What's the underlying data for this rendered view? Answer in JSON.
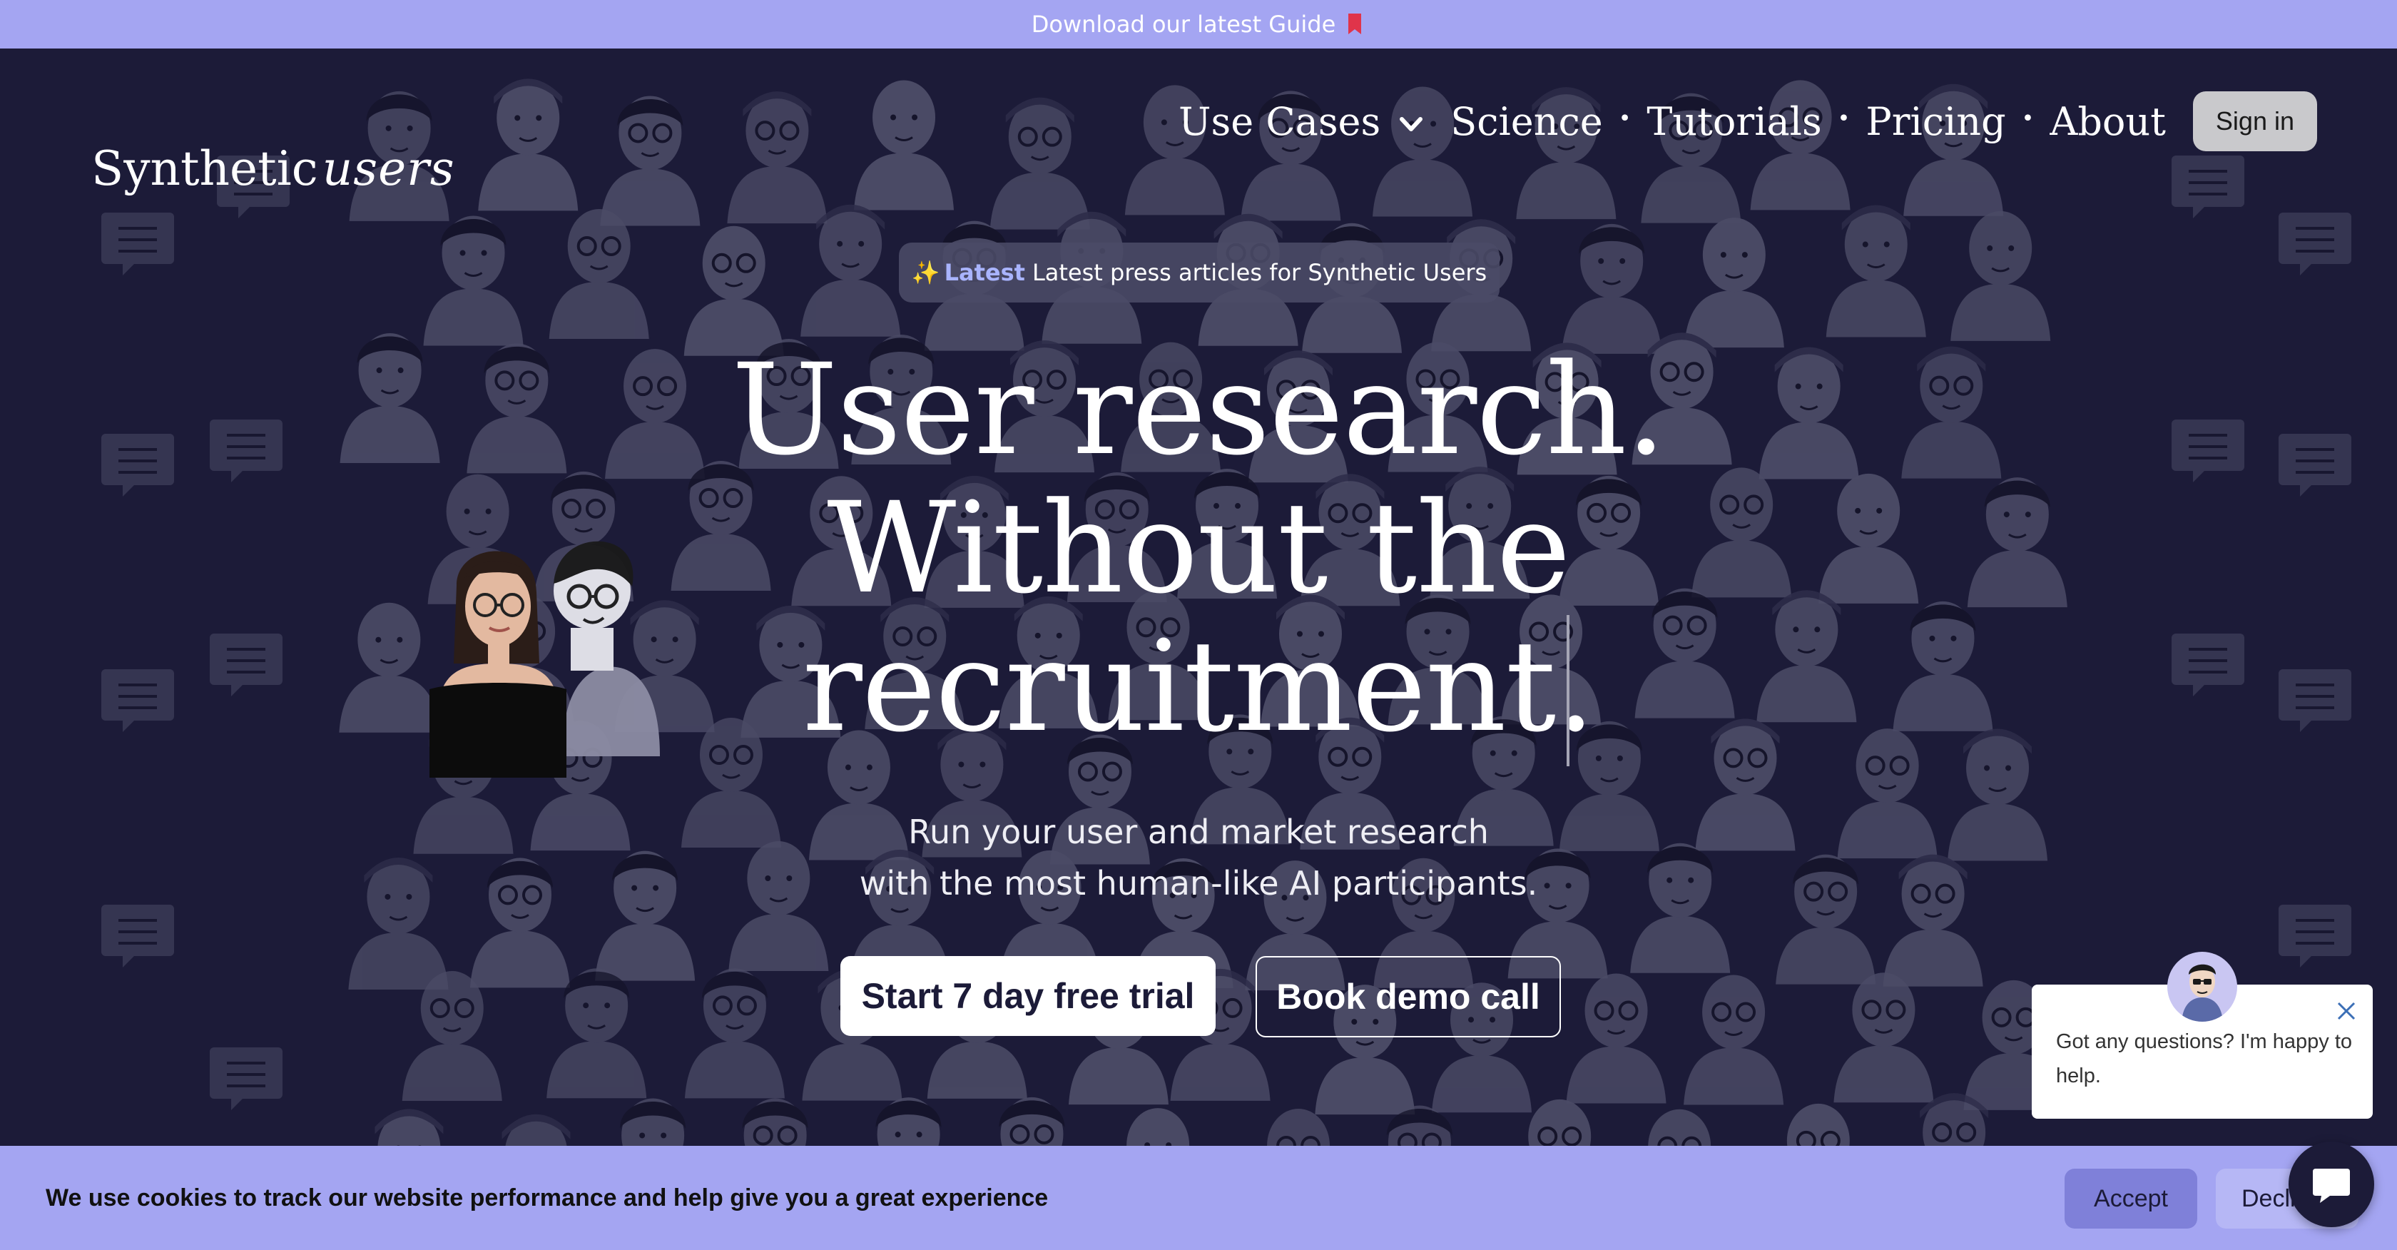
{
  "promo": {
    "text": "Download our latest Guide",
    "icon": "bookmark-icon"
  },
  "header": {
    "logo_main": "Synthetic",
    "logo_script": "users",
    "nav": [
      {
        "label": "Use Cases",
        "has_dropdown": true
      },
      {
        "label": "Science"
      },
      {
        "label": "Tutorials"
      },
      {
        "label": "Pricing"
      },
      {
        "label": "About"
      }
    ],
    "separator": "•",
    "sign_in": "Sign in"
  },
  "press": {
    "sparkle": "✨",
    "tag": "Latest",
    "text": "Latest press articles for Synthetic Users"
  },
  "hero": {
    "title_lines": [
      "User research.",
      "Without the",
      "recruitment."
    ],
    "subtitle_lines": [
      "Run your user and market research",
      "with the most human-like AI participants."
    ]
  },
  "cta": {
    "primary": "Start 7 day free trial",
    "secondary": "Book demo call"
  },
  "chat": {
    "message": "Got any questions? I'm happy to help."
  },
  "cookie": {
    "message": "We use cookies to track our website performance and help give you a great experience",
    "accept": "Accept",
    "decline": "Decline"
  },
  "colors": {
    "background": "#1c1b38",
    "accent": "#a4a5f2",
    "accent_dark": "#7f80d9",
    "doodle": "#4b4b66"
  }
}
